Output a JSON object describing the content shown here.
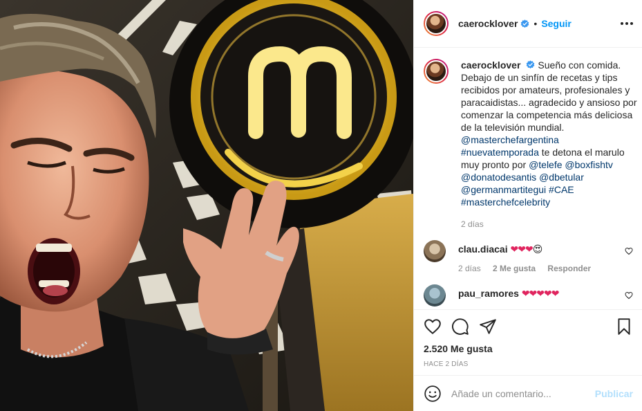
{
  "photo": {
    "logo_letter": "m",
    "icons": [
      "masterchef-logo"
    ]
  },
  "header": {
    "username": "caerocklover",
    "separator": "•",
    "follow_label": "Seguir",
    "icons": [
      "verified-badge-icon",
      "more-options-icon"
    ]
  },
  "caption": {
    "username": "caerocklover",
    "text_1": "Sueño con comida. Debajo de un sinfín de recetas y tips recibidos por amateurs, profesionales y paracaidistas... agradecido y ansioso por comenzar la competencia más deliciosa de la televisión mundial.",
    "mention_masterchef": "@masterchefargentina",
    "hashtag_nueva": "#nuevatemporada",
    "text_2": " te detona el marulo muy pronto por ",
    "mention_telefe": "@telefe",
    "mention_boxfish": "@boxfishtv",
    "mention_donato": "@donatodesantis",
    "mention_betular": "@dbetular",
    "mention_german": "@germanmartitegui",
    "hashtag_cae": "#CAE",
    "hashtag_celebrity": "#masterchefcelebrity",
    "time": "2 días"
  },
  "comments": [
    {
      "username": "clau.diacai",
      "hearts": "❤❤❤",
      "emoji": "😍",
      "time": "2 días",
      "likes": "2 Me gusta",
      "reply_label": "Responder"
    },
    {
      "username": "pau_ramores",
      "hearts": "❤❤❤❤❤"
    }
  ],
  "actions": {
    "likes_count": "2.520 Me gusta",
    "time_ago": "HACE 2 DÍAS",
    "icons": [
      "heart-icon",
      "comment-icon",
      "share-icon",
      "bookmark-icon"
    ]
  },
  "add_comment": {
    "placeholder": "Añade un comentario...",
    "publish_label": "Publicar",
    "icons": [
      "emoji-icon"
    ]
  },
  "colors": {
    "link": "#00376b",
    "follow": "#0095f6",
    "publish_disabled": "#b2dffc",
    "muted": "#8e8e8e",
    "logo_glow": "#f3d24a"
  }
}
